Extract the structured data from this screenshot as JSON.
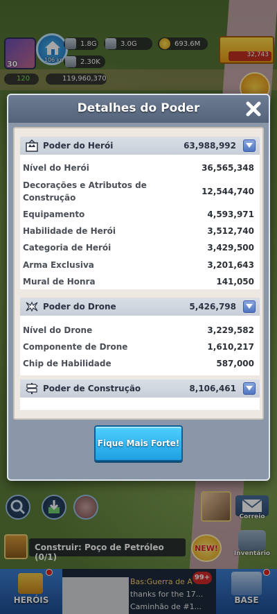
{
  "hud": {
    "hero_level": "30",
    "home_distance": "106 km",
    "resource_1": "1.8G",
    "resource_2": "3.0G",
    "gold": "693.6M",
    "resource_4": "2.30K",
    "stamina": "120",
    "power": "119,960,370",
    "shop_value": "32,743"
  },
  "dialog": {
    "title": "Detalhes do Poder",
    "sections": [
      {
        "title": "Poder do Herói",
        "value": "63,988,992",
        "rows": [
          {
            "label": "Nível do Herói",
            "value": "36,565,348"
          },
          {
            "label": "Decorações e Atributos de Construção",
            "value": "12,544,740"
          },
          {
            "label": "Equipamento",
            "value": "4,593,971"
          },
          {
            "label": "Habilidade de Herói",
            "value": "3,512,740"
          },
          {
            "label": "Categoria de Herói",
            "value": "3,429,500"
          },
          {
            "label": "Arma Exclusiva",
            "value": "3,201,643"
          },
          {
            "label": "Mural de Honra",
            "value": "141,050"
          }
        ]
      },
      {
        "title": "Poder do Drone",
        "value": "5,426,798",
        "rows": [
          {
            "label": "Nível do Drone",
            "value": "3,229,582"
          },
          {
            "label": "Componente de Drone",
            "value": "1,610,217"
          },
          {
            "label": "Chip de Habilidade",
            "value": "587,000"
          }
        ]
      },
      {
        "title": "Poder de Construção",
        "value": "8,106,461",
        "rows": []
      }
    ],
    "button_label": "Fique Mais Forte!"
  },
  "bottom": {
    "build_task": "Construir: Poço de Petróleo (0/1)",
    "new_badge": "NEW!",
    "mail_label": "Correio",
    "inventory_label": "Inventário",
    "heroes_label": "HERÓIS",
    "base_label": "BASE",
    "chat_line_1": "Bas:Guerra de A",
    "chat_line_2": "thanks for the 17...",
    "chat_line_3": "Caminhão de #1...",
    "chat_count": "99+"
  },
  "colors": {
    "button_blue": "#1ea0e2",
    "header_slate": "#54637a",
    "section_header": "#c8ced8"
  }
}
